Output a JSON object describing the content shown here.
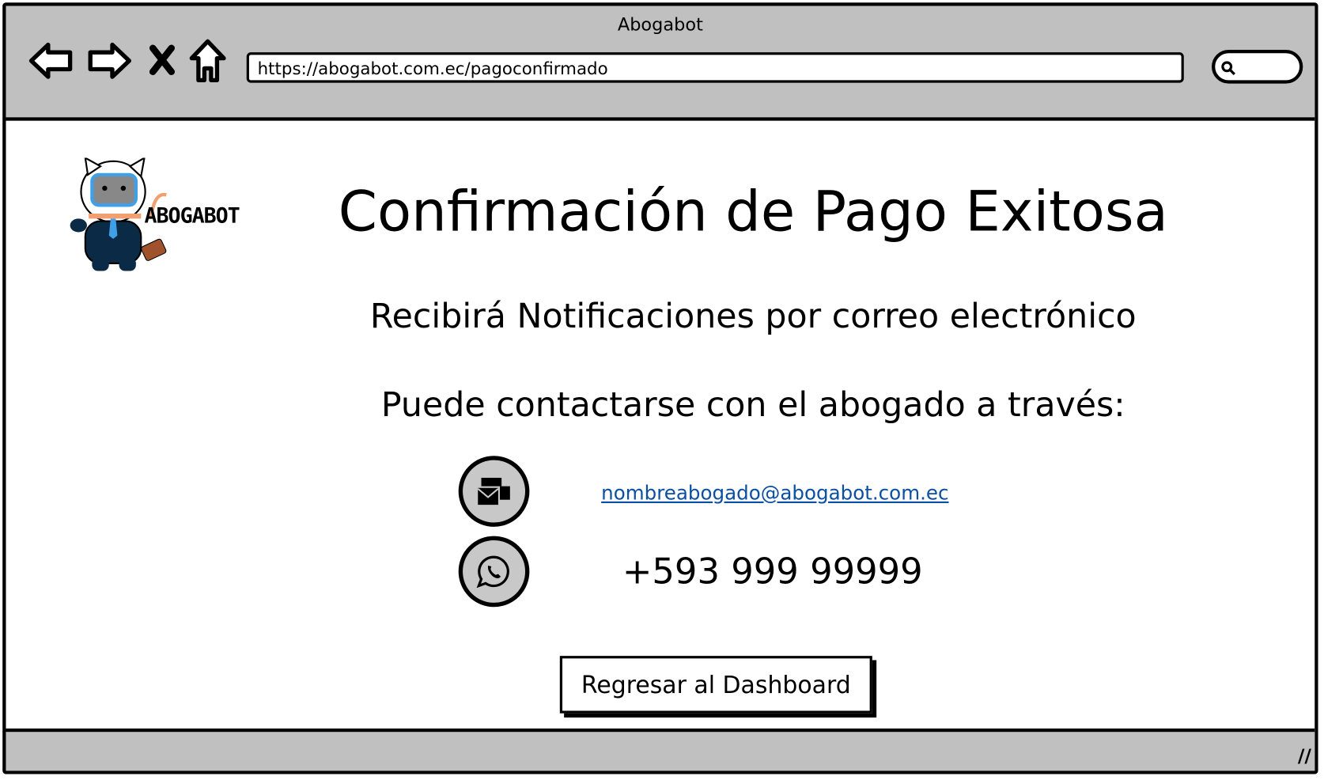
{
  "window": {
    "title": "Abogabot"
  },
  "browser": {
    "url": "https://abogabot.com.ec/pagoconfirmado",
    "icons": [
      "back-arrow-icon",
      "forward-arrow-icon",
      "close-x-icon",
      "home-icon",
      "search-icon"
    ]
  },
  "logo": {
    "text": "ABOGABOT"
  },
  "main": {
    "title": "Confirmación de Pago Exitosa",
    "notification_text": "Recibirá Notificaciones por correo electrónico",
    "contact_text": "Puede contactarse con el abogado a través:",
    "email": "nombreabogado@abogabot.com.ec",
    "phone": "+593 999 99999",
    "back_button": "Regresar al Dashboard"
  },
  "colors": {
    "chrome": "#c0c0c0",
    "link": "#0b4fa3",
    "icon_circle": "#c8c8c8"
  }
}
